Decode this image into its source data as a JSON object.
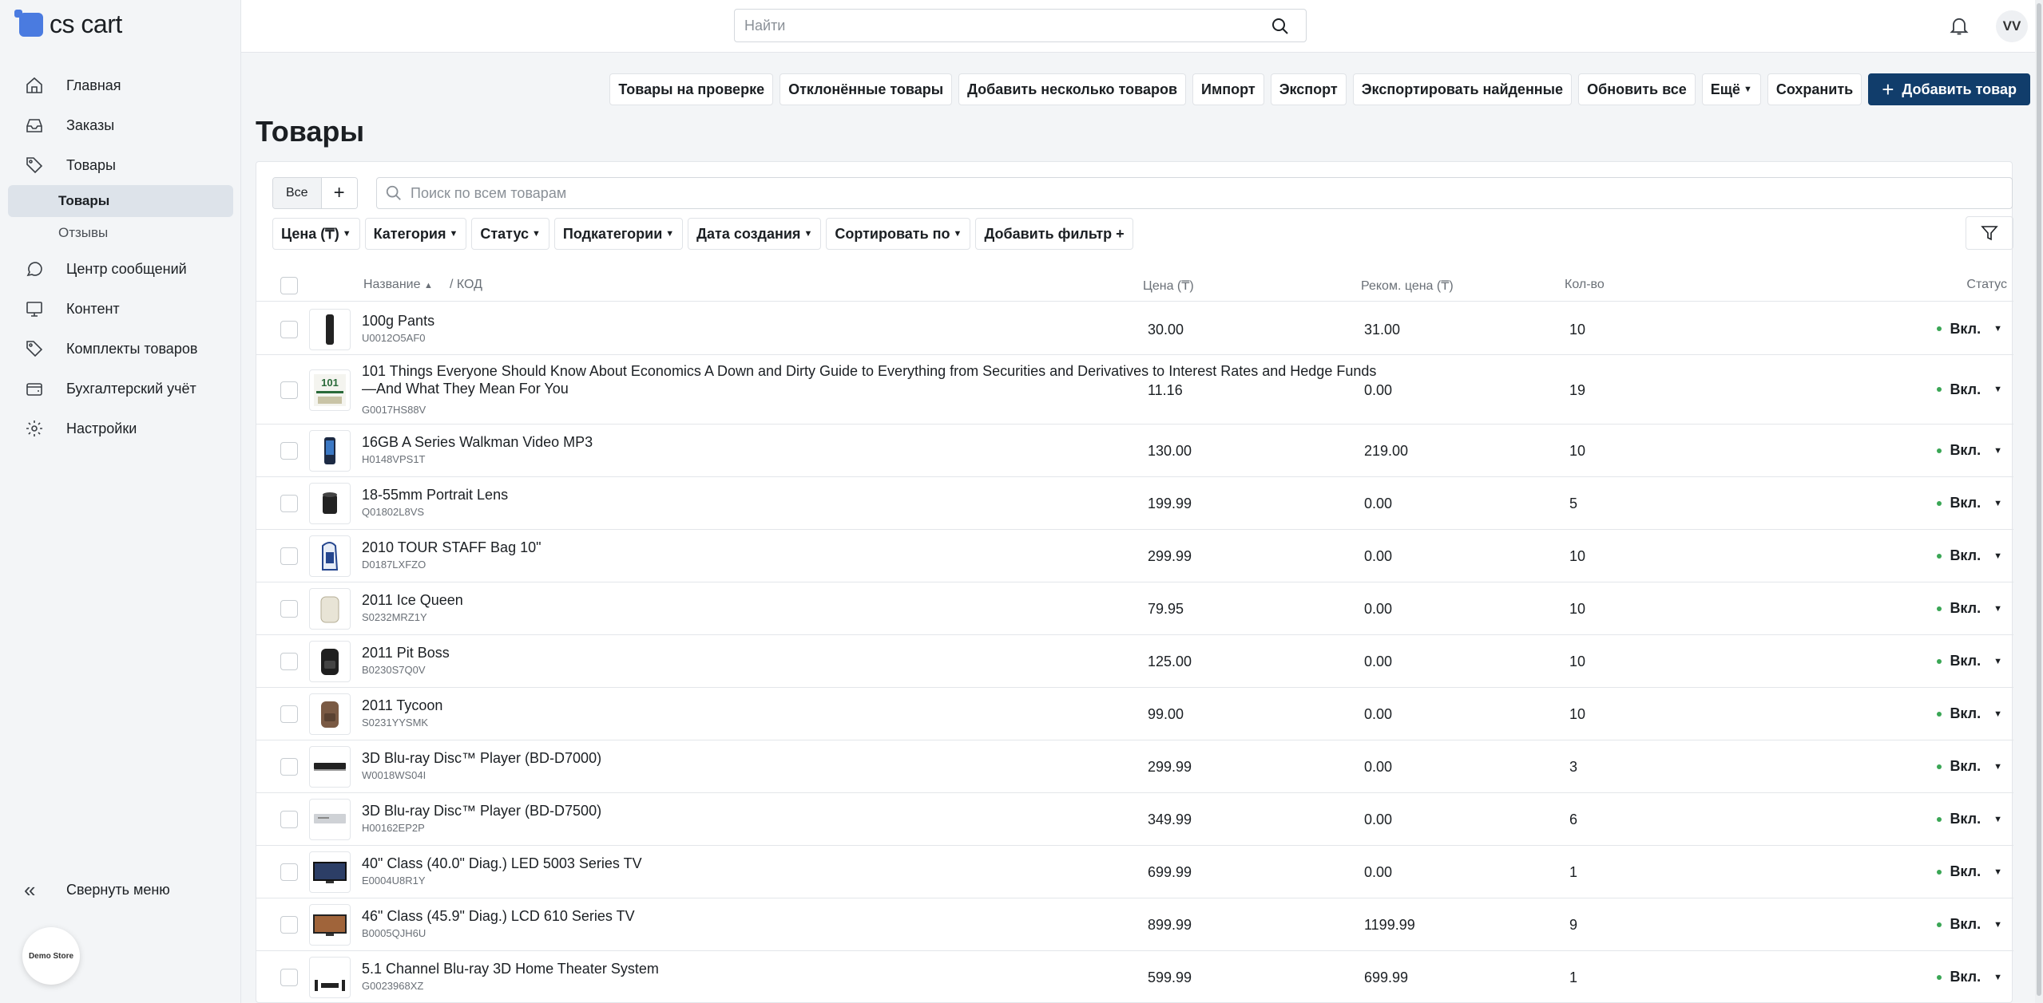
{
  "brand": {
    "name": "cs cart",
    "badge": "Demo Store"
  },
  "sidebar": {
    "items": [
      {
        "label": "Главная",
        "icon": "home-icon"
      },
      {
        "label": "Заказы",
        "icon": "inbox-icon"
      },
      {
        "label": "Товары",
        "icon": "tag-icon"
      }
    ],
    "sub": [
      {
        "label": "Товары"
      },
      {
        "label": "Отзывы"
      }
    ],
    "items2": [
      {
        "label": "Центр сообщений",
        "icon": "chat-icon"
      },
      {
        "label": "Контент",
        "icon": "monitor-icon"
      },
      {
        "label": "Комплекты товаров",
        "icon": "tag-icon"
      },
      {
        "label": "Бухгалтерский учёт",
        "icon": "wallet-icon"
      },
      {
        "label": "Настройки",
        "icon": "gear-icon"
      }
    ],
    "collapse_label": "Свернуть меню"
  },
  "topbar": {
    "search_placeholder": "Найти",
    "avatar": "VV"
  },
  "toolbar": {
    "buttons": [
      "Товары на проверке",
      "Отклонённые товары",
      "Добавить несколько товаров",
      "Импорт",
      "Экспорт",
      "Экспортировать найденные",
      "Обновить все"
    ],
    "more": "Ещё",
    "save": "Сохранить",
    "add": "Добавить товар"
  },
  "page": {
    "title": "Товары"
  },
  "tabs": {
    "all": "Все",
    "plus": "+"
  },
  "search": {
    "placeholder": "Поиск по всем товарам"
  },
  "filters": [
    "Цена (₸)",
    "Категория",
    "Статус",
    "Подкатегории",
    "Дата создания",
    "Сортировать по"
  ],
  "add_filter": "Добавить фильтр +",
  "table": {
    "headers": {
      "name": "Название",
      "code": "/  КОД",
      "price": "Цена (₸)",
      "rec_price": "Реком. цена (₸)",
      "qty": "Кол-во",
      "status": "Статус"
    },
    "rows": [
      {
        "name": "100g Pants",
        "code": "U0012O5AF0",
        "price": "30.00",
        "rec": "31.00",
        "qty": "10",
        "status": "Вкл."
      },
      {
        "name": "101 Things Everyone Should Know About Economics A Down and Dirty Guide to Everything from Securities and Derivatives to Interest Rates and Hedge Funds—And What They Mean For You",
        "code": "G0017HS88V",
        "price": "11.16",
        "rec": "0.00",
        "qty": "19",
        "status": "Вкл."
      },
      {
        "name": "16GB A Series Walkman Video MP3",
        "code": "H0148VPS1T",
        "price": "130.00",
        "rec": "219.00",
        "qty": "10",
        "status": "Вкл."
      },
      {
        "name": "18-55mm Portrait Lens",
        "code": "Q01802L8VS",
        "price": "199.99",
        "rec": "0.00",
        "qty": "5",
        "status": "Вкл."
      },
      {
        "name": "2010 TOUR STAFF Bag 10\"",
        "code": "D0187LXFZO",
        "price": "299.99",
        "rec": "0.00",
        "qty": "10",
        "status": "Вкл."
      },
      {
        "name": "2011 Ice Queen",
        "code": "S0232MRZ1Y",
        "price": "79.95",
        "rec": "0.00",
        "qty": "10",
        "status": "Вкл."
      },
      {
        "name": "2011 Pit Boss",
        "code": "B0230S7Q0V",
        "price": "125.00",
        "rec": "0.00",
        "qty": "10",
        "status": "Вкл."
      },
      {
        "name": "2011 Tycoon",
        "code": "S0231YYSMK",
        "price": "99.00",
        "rec": "0.00",
        "qty": "10",
        "status": "Вкл."
      },
      {
        "name": "3D Blu-ray Disc™ Player (BD-D7000)",
        "code": "W0018WS04I",
        "price": "299.99",
        "rec": "0.00",
        "qty": "3",
        "status": "Вкл."
      },
      {
        "name": "3D Blu-ray Disc™ Player (BD-D7500)",
        "code": "H00162EP2P",
        "price": "349.99",
        "rec": "0.00",
        "qty": "6",
        "status": "Вкл."
      },
      {
        "name": "40\" Class (40.0\" Diag.) LED 5003 Series TV",
        "code": "E0004U8R1Y",
        "price": "699.99",
        "rec": "0.00",
        "qty": "1",
        "status": "Вкл."
      },
      {
        "name": "46\" Class (45.9\" Diag.) LCD 610 Series TV",
        "code": "B0005QJH6U",
        "price": "899.99",
        "rec": "1199.99",
        "qty": "9",
        "status": "Вкл."
      },
      {
        "name": "5.1 Channel Blu-ray 3D Home Theater System",
        "code": "G0023968XZ",
        "price": "599.99",
        "rec": "699.99",
        "qty": "1",
        "status": "Вкл."
      }
    ]
  }
}
